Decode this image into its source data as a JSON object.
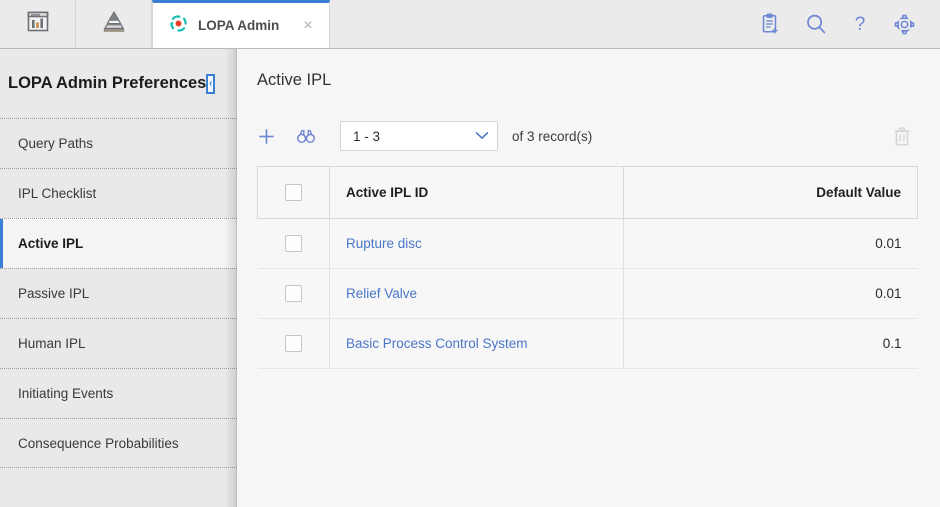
{
  "topbar": {
    "app_icons": [
      {
        "name": "dashboard-icon",
        "label": "Dashboard"
      },
      {
        "name": "pyramid-icon",
        "label": "Hierarchy"
      }
    ],
    "tab": {
      "label": "LOPA Admin",
      "icon": "lopa-refresh-icon",
      "close_label": "×"
    },
    "actions": [
      {
        "name": "new-record-icon",
        "label": "New Record"
      },
      {
        "name": "search-icon",
        "label": "Search"
      },
      {
        "name": "help-icon",
        "label": "Help"
      },
      {
        "name": "gear-icon",
        "label": "Settings"
      }
    ]
  },
  "sidebar": {
    "title": "LOPA Admin Preferences",
    "collapse_label": "‹",
    "items": [
      {
        "label": "Query Paths",
        "active": false
      },
      {
        "label": "IPL Checklist",
        "active": false
      },
      {
        "label": "Active IPL",
        "active": true
      },
      {
        "label": "Passive IPL",
        "active": false
      },
      {
        "label": "Human IPL",
        "active": false
      },
      {
        "label": "Initiating Events",
        "active": false
      },
      {
        "label": "Consequence Probabilities",
        "active": false
      }
    ]
  },
  "main": {
    "page_title": "Active IPL",
    "toolbar": {
      "add_label": "Add",
      "find_label": "Find",
      "range_value": "1 - 3",
      "record_count_text": "of  3  record(s)",
      "delete_label": "Delete"
    },
    "table": {
      "columns": [
        {
          "key": "name",
          "label": "Active IPL ID",
          "align": "left"
        },
        {
          "key": "value",
          "label": "Default Value",
          "align": "right"
        }
      ],
      "rows": [
        {
          "name": "Rupture disc",
          "value": "0.01"
        },
        {
          "name": "Relief Valve",
          "value": "0.01"
        },
        {
          "name": "Basic Process Control System",
          "value": "0.1"
        }
      ]
    }
  },
  "colors": {
    "accent_blue": "#3b7fd4",
    "link_blue": "#4a76c9",
    "topbar_bg": "#ebebeb",
    "sidebar_bg": "#e9e9e9",
    "main_bg": "#f6f6f6",
    "tab_icon_teal": "#17bdb4",
    "tab_icon_red": "#e8402a"
  }
}
